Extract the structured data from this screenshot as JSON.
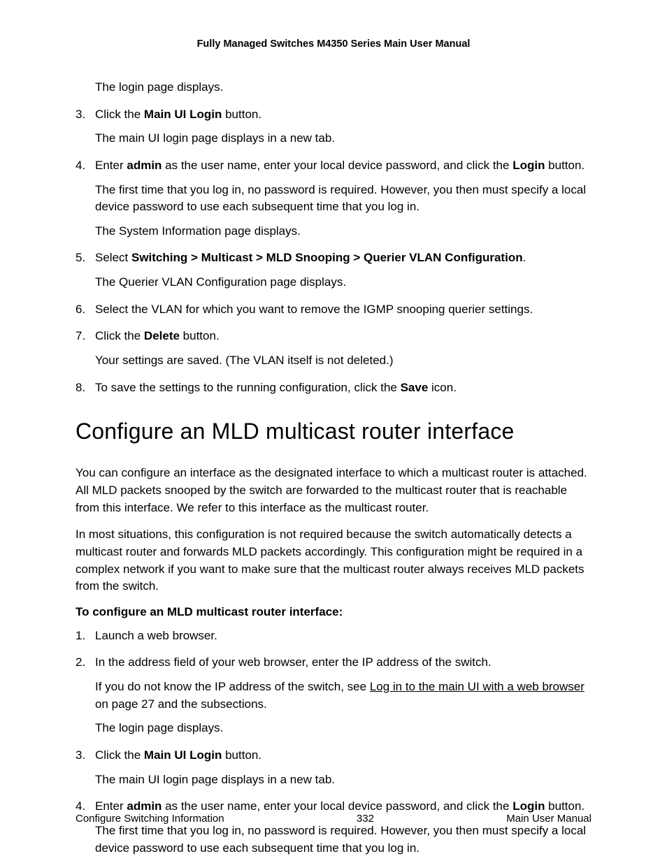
{
  "header": {
    "title": "Fully Managed Switches M4350 Series Main User Manual"
  },
  "continuation": {
    "loginDisplays": "The login page displays.",
    "step3_click": "Click the ",
    "step3_bold": "Main UI Login",
    "step3_after": " button.",
    "step3_result": "The main UI login page displays in a new tab.",
    "step4_a": "Enter ",
    "step4_b": "admin",
    "step4_c": " as the user name, enter your local device password, and click the ",
    "step4_d": "Login",
    "step4_e": " button.",
    "step4_p1": "The first time that you log in, no password is required. However, you then must specify a local device password to use each subsequent time that you log in.",
    "step4_p2": "The System Information page displays.",
    "step5_a": "Select ",
    "step5_b": "Switching > Multicast > MLD Snooping > Querier VLAN Configuration",
    "step5_c": ".",
    "step5_result": "The Querier VLAN Configuration page displays.",
    "step6": "Select the VLAN for which you want to remove the IGMP snooping querier settings.",
    "step7_a": "Click the ",
    "step7_b": "Delete",
    "step7_c": " button.",
    "step7_result": "Your settings are saved. (The VLAN itself is not deleted.)",
    "step8_a": "To save the settings to the running configuration, click the ",
    "step8_b": "Save",
    "step8_c": " icon."
  },
  "section": {
    "heading": "Configure an MLD multicast router interface",
    "intro1": "You can configure an interface as the designated interface to which a multicast router is attached. All MLD packets snooped by the switch are forwarded to the multicast router that is reachable from this interface. We refer to this interface as the multicast router.",
    "intro2": "In most situations, this configuration is not required because the switch automatically detects a multicast router and forwards MLD packets accordingly. This configuration might be required in a complex network if you want to make sure that the multicast router always receives MLD packets from the switch.",
    "subhead": "To configure an MLD multicast router interface:",
    "s1": "Launch a web browser.",
    "s2": "In the address field of your web browser, enter the IP address of the switch.",
    "s2_p_a": "If you do not know the IP address of the switch, see ",
    "s2_link": "Log in to the main UI with a web browser",
    "s2_p_b": " on page 27 and the subsections.",
    "s2_p2": "The login page displays.",
    "s3_a": "Click the ",
    "s3_b": "Main UI Login",
    "s3_c": " button.",
    "s3_result": "The main UI login page displays in a new tab.",
    "s4_a": "Enter ",
    "s4_b": "admin",
    "s4_c": " as the user name, enter your local device password, and click the ",
    "s4_d": "Login",
    "s4_e": " button.",
    "s4_p": "The first time that you log in, no password is required. However, you then must specify a local device password to use each subsequent time that you log in."
  },
  "footer": {
    "left": "Configure Switching Information",
    "center": "332",
    "right": "Main User Manual"
  },
  "nums": {
    "n3": "3.",
    "n4": "4.",
    "n5": "5.",
    "n6": "6.",
    "n7": "7.",
    "n8": "8.",
    "n1": "1.",
    "n2": "2."
  }
}
